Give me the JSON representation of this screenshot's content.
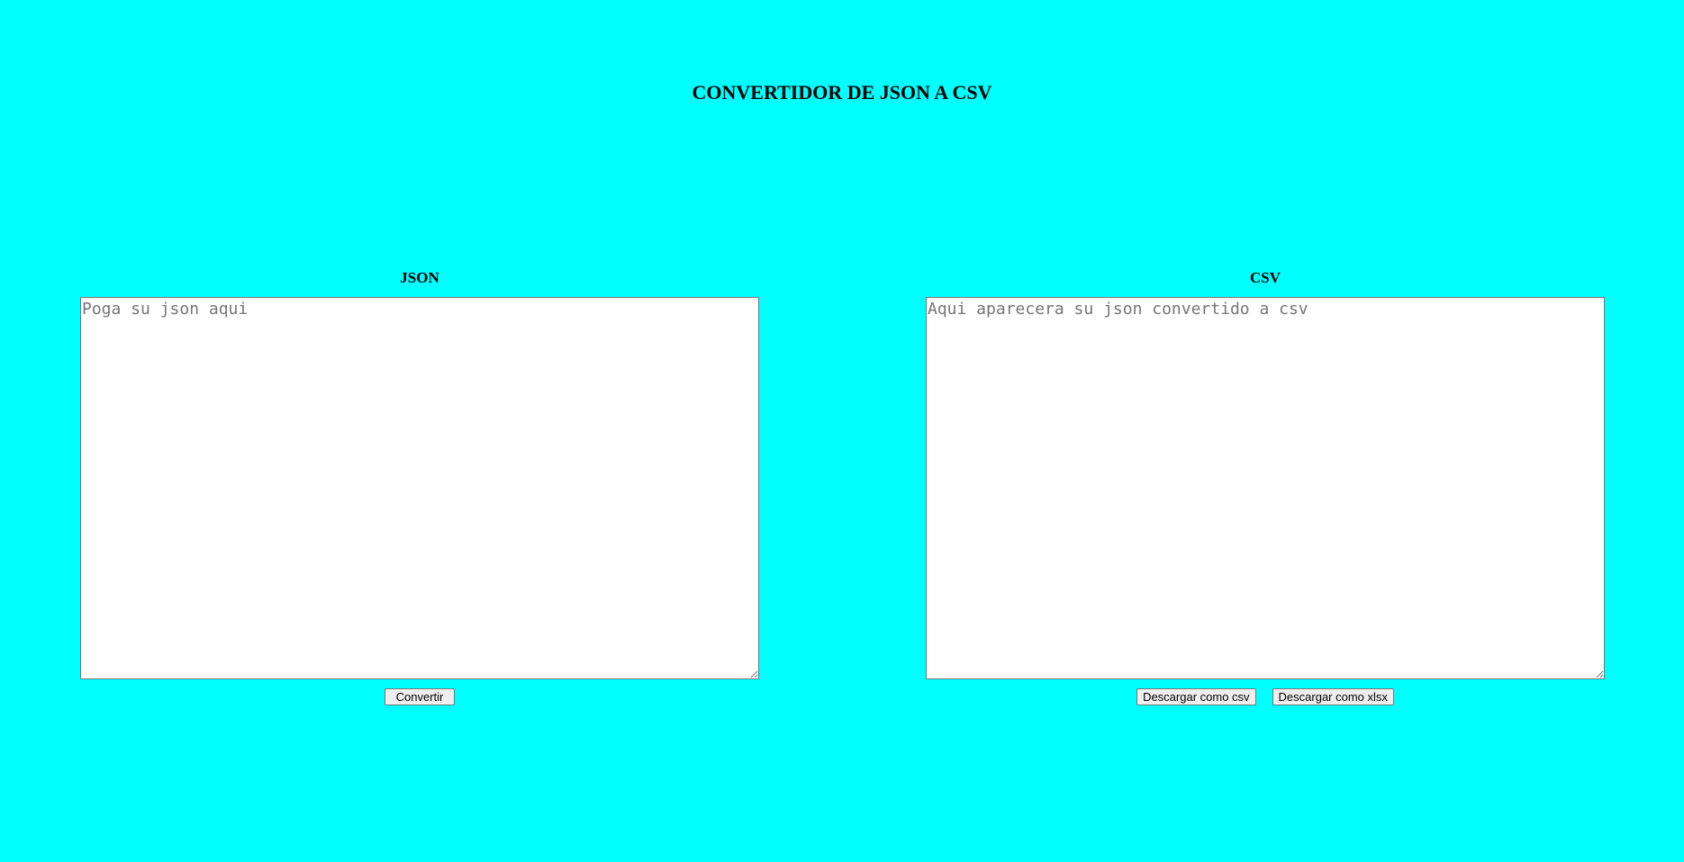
{
  "page": {
    "title": "CONVERTIDOR DE JSON A CSV",
    "background_color": "#00ffff"
  },
  "json_panel": {
    "heading": "JSON",
    "input_value": "",
    "placeholder": "Poga su json aqui",
    "convert_label": "Convertir"
  },
  "csv_panel": {
    "heading": "CSV",
    "output_value": "",
    "placeholder": "Aqui aparecera su json convertido a csv",
    "download_csv_label": "Descargar como csv",
    "download_xlsx_label": "Descargar como xlsx"
  }
}
